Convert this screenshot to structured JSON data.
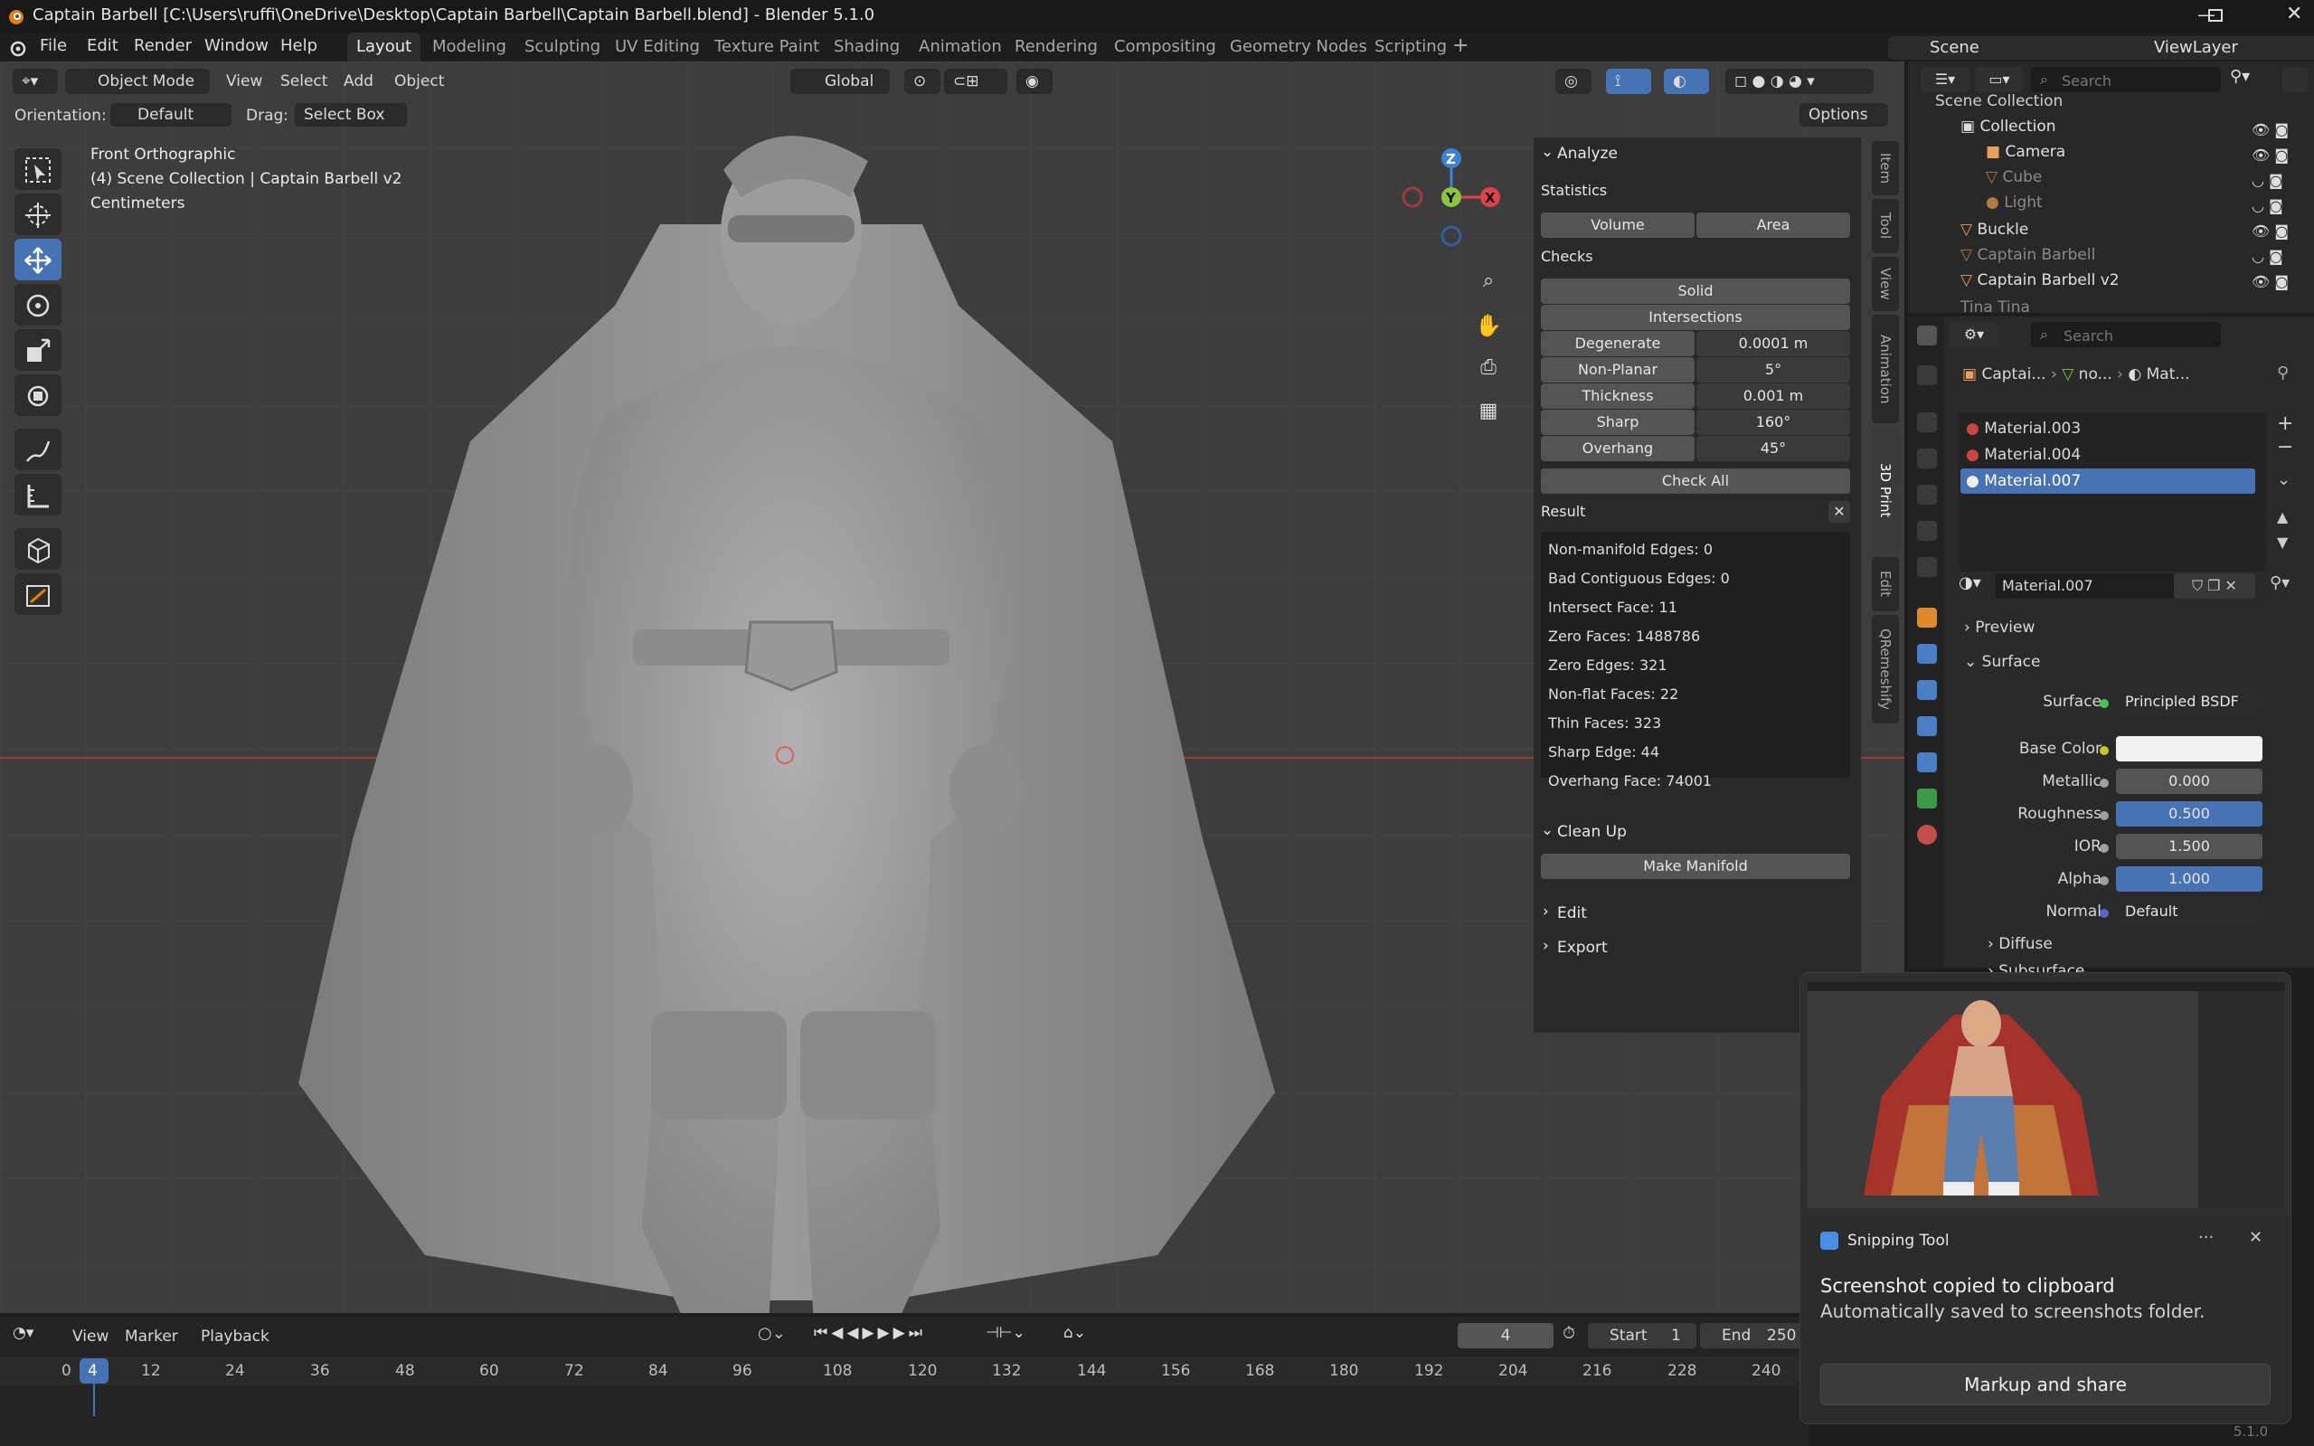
{
  "title": "Captain Barbell [C:\\Users\\ruffi\\OneDrive\\Desktop\\Captain Barbell\\Captain Barbell.blend] - Blender 5.1.0",
  "menu": [
    "File",
    "Edit",
    "Render",
    "Window",
    "Help"
  ],
  "workspaces": [
    "Layout",
    "Modeling",
    "Sculpting",
    "UV Editing",
    "Texture Paint",
    "Shading",
    "Animation",
    "Rendering",
    "Compositing",
    "Geometry Nodes",
    "Scripting"
  ],
  "scene": "Scene",
  "view_layer": "ViewLayer",
  "viewport_header": {
    "mode": "Object Mode",
    "menus": [
      "View",
      "Select",
      "Add",
      "Object"
    ],
    "transform": "Global",
    "orientation_label": "Orientation:",
    "orientation": "Default",
    "drag_label": "Drag:",
    "drag": "Select Box",
    "options": "Options"
  },
  "overlay": {
    "view": "Front Orthographic",
    "collection": "(4) Scene Collection | Captain Barbell v2",
    "units": "Centimeters"
  },
  "gizmo": {
    "z": "Z",
    "y": "Y",
    "x": "X"
  },
  "side_tabs": [
    "Item",
    "Tool",
    "View",
    "Animation",
    "3D Print",
    "Edit",
    "QRemeshify"
  ],
  "print3d": {
    "analyze": "Analyze",
    "statistics": "Statistics",
    "volume": "Volume",
    "area": "Area",
    "checks": "Checks",
    "solid": "Solid",
    "intersections": "Intersections",
    "check_rows": [
      {
        "label": "Degenerate",
        "value": "0.0001 m"
      },
      {
        "label": "Non-Planar",
        "value": "5°"
      },
      {
        "label": "Thickness",
        "value": "0.001 m"
      },
      {
        "label": "Sharp",
        "value": "160°"
      },
      {
        "label": "Overhang",
        "value": "45°"
      }
    ],
    "check_all": "Check All",
    "result": "Result",
    "results": [
      "Non-manifold Edges: 0",
      "Bad Contiguous Edges: 0",
      "Intersect Face: 11",
      "Zero Faces: 1488786",
      "Zero Edges: 321",
      "Non-flat Faces: 22",
      "Thin Faces: 323",
      "Sharp Edge: 44",
      "Overhang Face: 74001"
    ],
    "cleanup": "Clean Up",
    "make_manifold": "Make Manifold",
    "edit": "Edit",
    "export": "Export"
  },
  "outliner": {
    "search_placeholder": "Search",
    "rows": [
      "Scene Collection",
      "Collection",
      "Camera",
      "Cube",
      "Light",
      "Buckle",
      "Captain Barbell",
      "Captain Barbell v2",
      "Tina Tina"
    ]
  },
  "properties": {
    "search_placeholder": "Search",
    "breadcrumb": [
      "Captai...",
      "no...",
      "Mat..."
    ],
    "materials": [
      "Material.003",
      "Material.004",
      "Material.007"
    ],
    "active_material": "Material.007",
    "preview": "Preview",
    "surface_section": "Surface",
    "surface_label": "Surface",
    "surface_value": "Principled BSDF",
    "base_color_label": "Base Color",
    "fields": [
      {
        "label": "Metallic",
        "value": "0.000"
      },
      {
        "label": "Roughness",
        "value": "0.500"
      },
      {
        "label": "IOR",
        "value": "1.500"
      },
      {
        "label": "Alpha",
        "value": "1.000"
      }
    ],
    "normal_label": "Normal",
    "normal_value": "Default",
    "diffuse": "Diffuse",
    "subsurface": "Subsurface"
  },
  "timeline": {
    "menus": [
      "View",
      "Marker",
      "Playback"
    ],
    "current_frame": "4",
    "start_label": "Start",
    "start": "1",
    "end_label": "End",
    "end": "250",
    "ticks": [
      "0",
      "4",
      "12",
      "24",
      "36",
      "48",
      "60",
      "72",
      "84",
      "96",
      "108",
      "120",
      "132",
      "144",
      "156",
      "168",
      "180",
      "192",
      "204",
      "216",
      "228",
      "240"
    ]
  },
  "toast": {
    "app": "Snipping Tool",
    "more": "···",
    "heading": "Screenshot copied to clipboard",
    "body": "Automatically saved to screenshots folder.",
    "button": "Markup and share"
  },
  "version": "5.1.0",
  "colors": {
    "accent": "#4772b3",
    "x_axis": "#e0424d",
    "y_axis": "#8bc43f",
    "z_axis": "#3e82d6",
    "active_tab": "#4772b3"
  }
}
